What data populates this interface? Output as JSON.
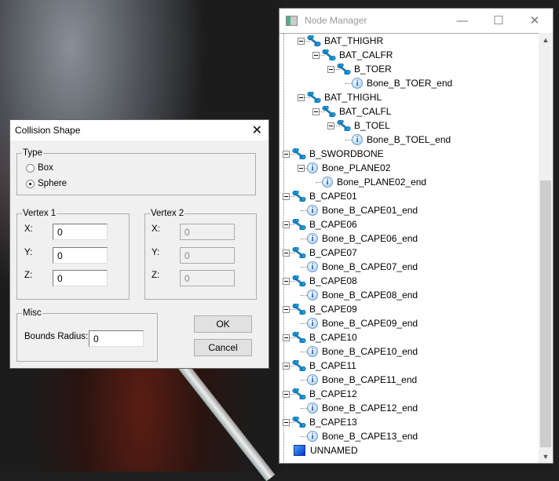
{
  "node_manager": {
    "title": "Node Manager",
    "nodes": [
      {
        "label": "BAT_THIGHR",
        "level": 1,
        "type": "bone",
        "expanded": true
      },
      {
        "label": "BAT_CALFR",
        "level": 2,
        "type": "bone",
        "expanded": true
      },
      {
        "label": "B_TOER",
        "level": 3,
        "type": "bone",
        "expanded": true
      },
      {
        "label": "Bone_B_TOER_end",
        "level": 4,
        "type": "info"
      },
      {
        "label": "BAT_THIGHL",
        "level": 1,
        "type": "bone",
        "expanded": true
      },
      {
        "label": "BAT_CALFL",
        "level": 2,
        "type": "bone",
        "expanded": true
      },
      {
        "label": "B_TOEL",
        "level": 3,
        "type": "bone",
        "expanded": true
      },
      {
        "label": "Bone_B_TOEL_end",
        "level": 4,
        "type": "info"
      },
      {
        "label": "B_SWORDBONE",
        "level": 0,
        "type": "bone",
        "expanded": true
      },
      {
        "label": "Bone_PLANE02",
        "level": 1,
        "type": "info",
        "expanded": true
      },
      {
        "label": "Bone_PLANE02_end",
        "level": 2,
        "type": "info"
      },
      {
        "label": "B_CAPE01",
        "level": 0,
        "type": "bone",
        "expanded": true
      },
      {
        "label": "Bone_B_CAPE01_end",
        "level": 1,
        "type": "info"
      },
      {
        "label": "B_CAPE06",
        "level": 0,
        "type": "bone",
        "expanded": true
      },
      {
        "label": "Bone_B_CAPE06_end",
        "level": 1,
        "type": "info"
      },
      {
        "label": "B_CAPE07",
        "level": 0,
        "type": "bone",
        "expanded": true
      },
      {
        "label": "Bone_B_CAPE07_end",
        "level": 1,
        "type": "info"
      },
      {
        "label": "B_CAPE08",
        "level": 0,
        "type": "bone",
        "expanded": true
      },
      {
        "label": "Bone_B_CAPE08_end",
        "level": 1,
        "type": "info"
      },
      {
        "label": "B_CAPE09",
        "level": 0,
        "type": "bone",
        "expanded": true
      },
      {
        "label": "Bone_B_CAPE09_end",
        "level": 1,
        "type": "info"
      },
      {
        "label": "B_CAPE10",
        "level": 0,
        "type": "bone",
        "expanded": true
      },
      {
        "label": "Bone_B_CAPE10_end",
        "level": 1,
        "type": "info"
      },
      {
        "label": "B_CAPE11",
        "level": 0,
        "type": "bone",
        "expanded": true
      },
      {
        "label": "Bone_B_CAPE11_end",
        "level": 1,
        "type": "info"
      },
      {
        "label": "B_CAPE12",
        "level": 0,
        "type": "bone",
        "expanded": true
      },
      {
        "label": "Bone_B_CAPE12_end",
        "level": 1,
        "type": "info"
      },
      {
        "label": "B_CAPE13",
        "level": 0,
        "type": "bone",
        "expanded": true
      },
      {
        "label": "Bone_B_CAPE13_end",
        "level": 1,
        "type": "info"
      },
      {
        "label": "UNNAMED",
        "level": -1,
        "type": "cube"
      }
    ]
  },
  "collision": {
    "title": "Collision Shape",
    "type_label": "Type",
    "box": "Box",
    "sphere": "Sphere",
    "selected": "Sphere",
    "v1_label": "Vertex 1",
    "v2_label": "Vertex 2",
    "x": "X:",
    "y": "Y:",
    "z": "Z:",
    "v1": {
      "x": "0",
      "y": "0",
      "z": "0"
    },
    "v2": {
      "x": "0",
      "y": "0",
      "z": "0"
    },
    "misc_label": "Misc",
    "bounds_label": "Bounds Radius:",
    "bounds": "0",
    "ok": "OK",
    "cancel": "Cancel"
  }
}
